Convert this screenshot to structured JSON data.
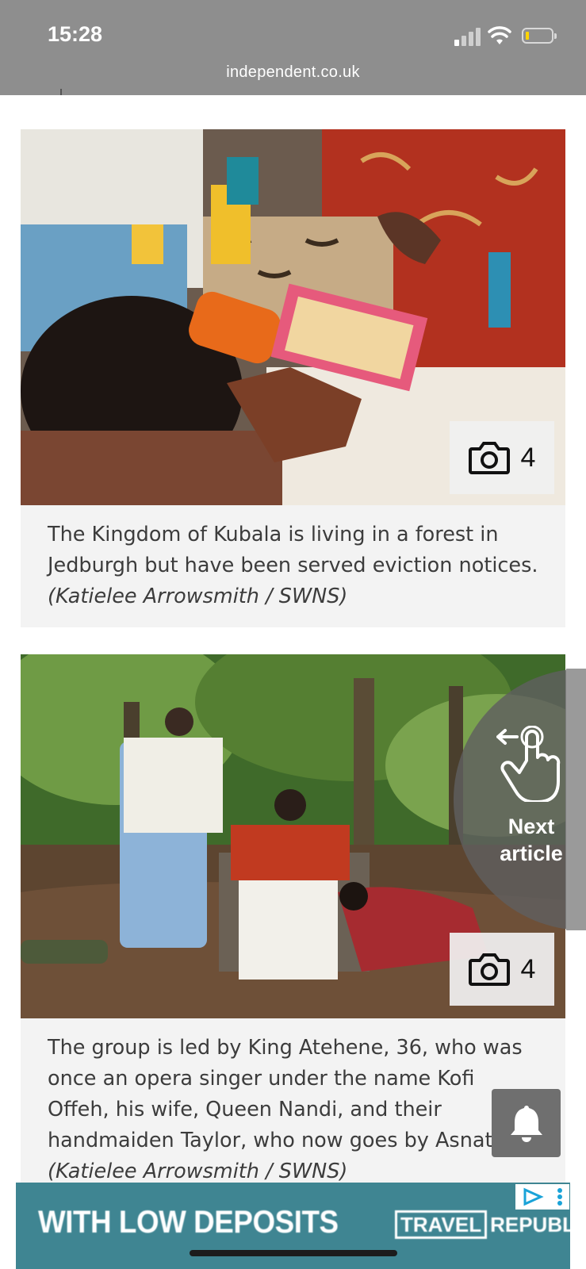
{
  "status_bar": {
    "time": "15:28"
  },
  "browser": {
    "url": "independent.co.uk"
  },
  "gallery": [
    {
      "count": "4",
      "caption": "The Kingdom of Kubala is living in a forest in Jedburgh but have been served eviction notices.",
      "credit": "(Katielee Arrowsmith / SWNS)"
    },
    {
      "count": "4",
      "caption": "The group is led by King Atehene, 36, who was once an opera singer under the name Kofi Offeh, his wife, Queen Nandi, and their handmaiden Taylor, who now goes by Asnat.",
      "credit": "(Katielee Arrowsmith / SWNS)"
    }
  ],
  "next_article": {
    "label_line1": "Next",
    "label_line2": "article"
  },
  "ad": {
    "headline": "WITH LOW DEPOSITS",
    "brand_part1": "TRAVEL",
    "brand_part2": "REPUBLIC",
    "colors": {
      "background": "#3f8592"
    }
  },
  "colors": {
    "topbar": "#8e8e8e",
    "caption_bg": "#f3f3f3",
    "caption_text": "#3c3c3c"
  },
  "icons": [
    "camera-icon",
    "swipe-hand-icon",
    "bell-icon",
    "ad-choices-icon",
    "wifi-icon",
    "battery-icon",
    "signal-icon"
  ]
}
